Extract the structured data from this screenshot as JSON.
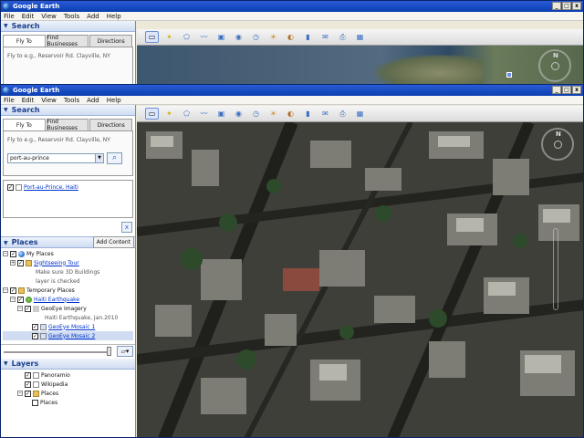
{
  "app": {
    "title": "Google Earth"
  },
  "menu": [
    "File",
    "Edit",
    "View",
    "Tools",
    "Add",
    "Help"
  ],
  "window_controls": [
    "_",
    "□",
    "x"
  ],
  "search": {
    "header": "Search",
    "tabs": [
      "Fly To",
      "Find Businesses",
      "Directions"
    ],
    "fly_to_hint": "Fly to e.g., Reservoir Rd. Clayville, NY",
    "query": "port-au-prince",
    "result": "Port-au-Prince, Haiti",
    "clear_label": "x"
  },
  "places": {
    "header": "Places",
    "add_content": "Add Content",
    "items": [
      {
        "label": "My Places"
      },
      {
        "label": "Sightseeing Tour"
      },
      {
        "label": "Make sure 3D Buildings"
      },
      {
        "label": "layer is checked"
      },
      {
        "label": "Temporary Places"
      },
      {
        "label": "Haiti Earthquake"
      },
      {
        "label": "GeoEye Imagery"
      },
      {
        "label": "Haiti Earthquake, Jan.2010"
      },
      {
        "label": "GeoEye Mosaic 1"
      },
      {
        "label": "GeoEye Mosaic 2"
      }
    ]
  },
  "layers": {
    "header": "Layers",
    "items": [
      "Panoramio",
      "Wikipedia",
      "Places",
      "Places"
    ]
  },
  "compass": {
    "north": "N"
  },
  "colors": {
    "title_bar": "#0a3fb0",
    "panel_header": "#1a3e8c",
    "link": "#0033cc"
  }
}
